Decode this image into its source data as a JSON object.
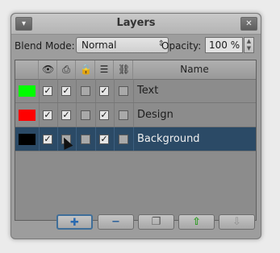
{
  "window": {
    "title": "Layers",
    "menu_icon": "chevron-down-icon",
    "close_icon": "close-icon"
  },
  "toolbar": {
    "blend_mode_label": "Blend Mode:",
    "blend_mode_value": "Normal",
    "opacity_label": "Opacity:",
    "opacity_value": "100 %"
  },
  "columns": {
    "icons": [
      "eye-icon",
      "print-icon",
      "lock-icon",
      "auto-fill-icon",
      "link-icon"
    ],
    "name_header": "Name"
  },
  "layers": [
    {
      "name": "Text",
      "color": "#00ff00",
      "visible": true,
      "print": true,
      "lock": false,
      "fill": true,
      "link": false,
      "selected": false
    },
    {
      "name": "Design",
      "color": "#ff0000",
      "visible": true,
      "print": true,
      "lock": false,
      "fill": true,
      "link": false,
      "selected": false
    },
    {
      "name": "Background",
      "color": "#000000",
      "visible": true,
      "print": false,
      "lock": false,
      "fill": true,
      "link": false,
      "selected": true
    }
  ],
  "buttons": {
    "add_icon": "plus-icon",
    "remove_icon": "minus-icon",
    "duplicate_icon": "duplicate-icon",
    "raise_icon": "arrow-up-icon",
    "lower_icon": "arrow-down-icon"
  },
  "colors": {
    "selection": "#2b4a66",
    "panel": "#9d9d9d"
  }
}
